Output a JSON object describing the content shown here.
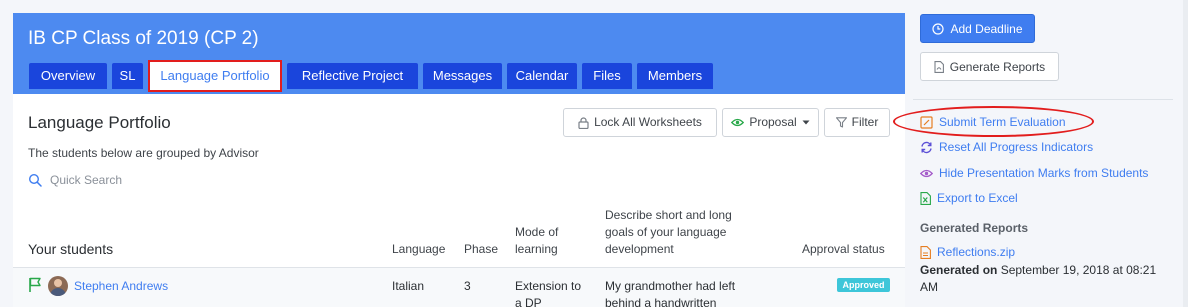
{
  "header": {
    "class_title": "IB CP Class of 2019 (CP 2)",
    "tabs": [
      {
        "label": "Overview",
        "active": false
      },
      {
        "label": "SL",
        "active": false
      },
      {
        "label": "Language Portfolio",
        "active": true
      },
      {
        "label": "Reflective Project",
        "active": false
      },
      {
        "label": "Messages",
        "active": false
      },
      {
        "label": "Calendar",
        "active": false
      },
      {
        "label": "Files",
        "active": false
      },
      {
        "label": "Members",
        "active": false
      }
    ]
  },
  "content": {
    "title": "Language Portfolio",
    "subtitle": "The students below are grouped by Advisor",
    "search_placeholder": "Quick Search",
    "toolbar": {
      "lock_label": "Lock All Worksheets",
      "proposal_label": "Proposal",
      "filter_label": "Filter"
    }
  },
  "table": {
    "headers": {
      "students": "Your students",
      "language": "Language",
      "phase": "Phase",
      "mode_line1": "Mode of",
      "mode_line2": "learning",
      "goals_line1": "Describe short and long",
      "goals_line2": "goals of your language",
      "goals_line3": "development",
      "approval": "Approval status"
    },
    "rows": [
      {
        "student": "Stephen Andrews",
        "language": "Italian",
        "phase": "3",
        "mode_line1": "Extension to",
        "mode_line2": "a DP",
        "goals_line1": "My grandmother had left",
        "goals_line2": "behind a handwritten",
        "approval": "Approved"
      }
    ]
  },
  "sidebar": {
    "add_deadline": "Add Deadline",
    "generate_reports": "Generate Reports",
    "links": {
      "submit_term_evaluation": "Submit Term Evaluation",
      "reset_progress": "Reset All Progress Indicators",
      "hide_marks": "Hide Presentation Marks from Students",
      "export_excel": "Export to Excel"
    },
    "generated_reports_heading": "Generated Reports",
    "report_file": "Reflections.zip",
    "generated_on_label": "Generated on",
    "generated_on_value": "September 19, 2018 at 08:21 AM"
  },
  "colors": {
    "header_bg": "#4d8af0",
    "tab_bg": "#1a45dc",
    "link": "#3f7df0",
    "highlight": "#e21d1d",
    "badge": "#3dc6d9"
  }
}
